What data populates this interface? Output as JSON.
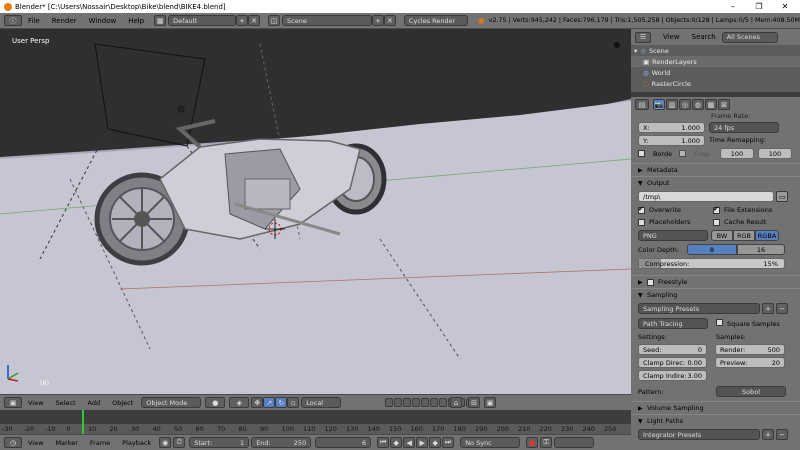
{
  "window": {
    "title": "Blender* [C:\\Users\\Nossair\\Desktop\\Bike\\blend\\BIKE4.blend]",
    "controls": [
      "–",
      "❐",
      "✕"
    ]
  },
  "topbar": {
    "menus": [
      "File",
      "Render",
      "Window",
      "Help"
    ],
    "screen": "Default",
    "scene": "Scene",
    "engine": "Cycles Render",
    "stats": "v2.75 | Verts:945,242 | Faces:796,179 | Tris:1,505,258 | Objects:0/128 | Lamps:0/5 | Mem:408.50M"
  },
  "viewport": {
    "label": "User Persp",
    "frame_label": "(6)"
  },
  "viewport_header": {
    "menus": [
      "View",
      "Select",
      "Add",
      "Object"
    ],
    "mode": "Object Mode",
    "pivot": "Local"
  },
  "timeline": {
    "ticks": [
      "-30",
      "-20",
      "-10",
      "0",
      "10",
      "20",
      "30",
      "40",
      "50",
      "60",
      "70",
      "80",
      "90",
      "100",
      "110",
      "120",
      "130",
      "140",
      "150",
      "160",
      "170",
      "180",
      "190",
      "200",
      "210",
      "220",
      "230",
      "240",
      "250"
    ],
    "current_frame": 6
  },
  "timeline_header": {
    "menus": [
      "View",
      "Marker",
      "Frame",
      "Playback"
    ],
    "start_label": "Start:",
    "start": "1",
    "end_label": "End:",
    "end": "250",
    "current": "6",
    "sync": "No Sync"
  },
  "outliner": {
    "menus": [
      "View",
      "Search"
    ],
    "filter": "All Scenes",
    "items": [
      "Scene",
      "RenderLayers",
      "World",
      "RasterCircle"
    ]
  },
  "props": {
    "partial_label": "Frame Rate:",
    "x_label": "X:",
    "x_value": "1.000",
    "y_label": "Y:",
    "y_value": "1.000",
    "fps": "24 fps",
    "time_remap_label": "Time Remapping:",
    "remap_old": "100",
    "remap_new": "100",
    "border_label": "Borde",
    "crop_label": "Crop",
    "metadata_label": "Metadata",
    "output_label": "Output",
    "output_path": "/tmp\\",
    "overwrite_label": "Overwrite",
    "file_ext_label": "File Extensions",
    "placeholders_label": "Placeholders",
    "cache_result_label": "Cache Result",
    "format": "PNG",
    "bw": "BW",
    "rgb": "RGB",
    "rgba": "RGBA",
    "color_depth_label": "Color Depth:",
    "depth_8": "8",
    "depth_16": "16",
    "compression_label": "Compression:",
    "compression_value": "15%",
    "compression_fraction": 0.15,
    "freestyle_label": "Freestyle",
    "sampling_label": "Sampling",
    "sampling_presets": "Sampling Presets",
    "path_tracing": "Path Tracing",
    "square_samples_label": "Square Samples",
    "settings_label": "Settings:",
    "samples_label": "Samples:",
    "seed_label": "Seed:",
    "seed_value": "0",
    "render_label": "Render:",
    "render_value": "500",
    "clamp_direct_label": "Clamp Direc:",
    "clamp_direct_value": "0.00",
    "preview_label": "Preview:",
    "preview_value": "20",
    "clamp_indirect_label": "Clamp Indire:",
    "clamp_indirect_value": "3.00",
    "pattern_label": "Pattern:",
    "pattern_value": "Sobol",
    "volume_sampling_label": "Volume Sampling",
    "light_paths_label": "Light Paths",
    "integrator_presets": "Integrator Presets"
  },
  "colors": {
    "accent": "#5680c2",
    "viewport_bg": "#a8a7b8",
    "panel_bg": "#727272",
    "floor": "#c6c5d2"
  }
}
